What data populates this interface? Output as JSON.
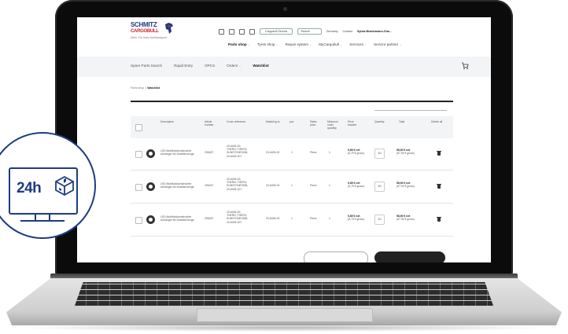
{
  "brand": {
    "name": "SCHMITZ",
    "sub": "CARGOBULL",
    "tagline": "Mehr. Für Ihren Kühltransport."
  },
  "utility": {
    "select_value": "Cargobull Service",
    "search_placeholder": "Search",
    "country": "Germany",
    "contact": "Contact",
    "user": "Sylvia Mustermann-Cha..."
  },
  "main_nav": [
    "Parts shop",
    "Tyres shop",
    "Repair system",
    "MyCargobull",
    "Services",
    "Service partner"
  ],
  "sub_nav": [
    "Spare Parts Search",
    "Rapid Entry",
    "OPCS",
    "Orders",
    "Watchlist"
  ],
  "breadcrumb": {
    "home": "Parts shop",
    "current": "Watchlist"
  },
  "table": {
    "headers": [
      "Description",
      "Article number",
      "Cross reference",
      "Matching to",
      "pcs",
      "Sales price",
      "Minimum order quantity",
      "Price bracket",
      "Quantity",
      "Total",
      "Delete all"
    ],
    "rows": [
      {
        "description": [
          "LED Multifunktionsleuchte",
          "Anhänger für Nutzfahrzeuge"
        ],
        "article": "206187",
        "cross_ref": [
          "20-6405-00,",
          "THERN, THERO,",
          "SUNSTONE3336,",
          "20-6405-007"
        ],
        "matching": "20-6405-00",
        "pcs": "1",
        "price_unit": "Piece",
        "moq": "1",
        "price": "5,89 € net",
        "price_sub": "(6,79 € gross)",
        "quantity": "10",
        "total": "58,90 € net",
        "total_sub": "(67,90 € gross)"
      },
      {
        "description": [
          "LED Multifunktionsleuchte",
          "Anhänger für Nutzfahrzeuge"
        ],
        "article": "206187",
        "cross_ref": [
          "20-6405-00,",
          "THERN, THERO,",
          "SUNSTONE3336,",
          "20-6405-007"
        ],
        "matching": "20-6405-00",
        "pcs": "1",
        "price_unit": "Piece",
        "moq": "1",
        "price": "5,89 € net",
        "price_sub": "(6,79 € gross)",
        "quantity": "10",
        "total": "58,90 € net",
        "total_sub": "(67,90 € gross)"
      },
      {
        "description": [
          "LED Multifunktionsleuchte",
          "Anhänger für Nutzfahrzeuge"
        ],
        "article": "206187",
        "cross_ref": [
          "20-6405-00,",
          "THERN, THERO,",
          "SUNSTONE3336,",
          "20-6405-007"
        ],
        "matching": "20-6405-00",
        "pcs": "1",
        "price_unit": "Piece",
        "moq": "1",
        "price": "5,89 € net",
        "price_sub": "(6,79 € gross)",
        "quantity": "10",
        "total": "58,90 € net",
        "total_sub": "(67,90 € gross)"
      }
    ]
  },
  "badge": {
    "label": "24h"
  },
  "colors": {
    "brand_blue": "#1d3c82",
    "brand_red": "#d2242a",
    "laptop_bezel": "#0b0b0c"
  },
  "icons": [
    "cart-icon",
    "trash-icon",
    "parcel-cube-icon",
    "monitor-icon"
  ]
}
